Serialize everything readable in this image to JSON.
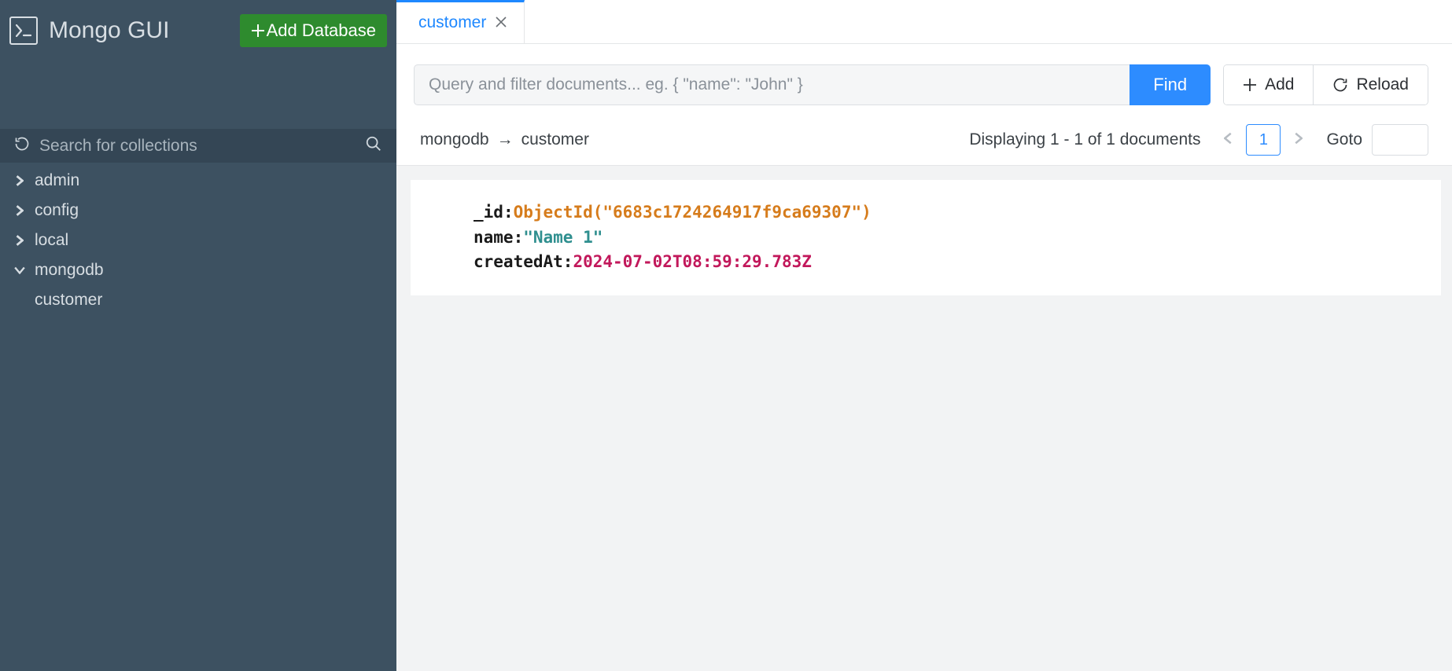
{
  "app": {
    "title": "Mongo GUI"
  },
  "sidebar": {
    "add_db_label": "Add Database",
    "search_placeholder": "Search for collections",
    "databases": [
      {
        "name": "admin",
        "expanded": false
      },
      {
        "name": "config",
        "expanded": false
      },
      {
        "name": "local",
        "expanded": false
      },
      {
        "name": "mongodb",
        "expanded": true,
        "collections": [
          {
            "name": "customer"
          }
        ]
      }
    ]
  },
  "tabs": [
    {
      "label": "customer",
      "active": true
    }
  ],
  "query": {
    "placeholder": "Query and filter documents... eg. { \"name\": \"John\" }",
    "find_label": "Find",
    "add_label": "Add",
    "reload_label": "Reload"
  },
  "pathbar": {
    "db": "mongodb",
    "collection": "customer",
    "status": "Displaying 1 - 1 of 1 documents",
    "page": "1",
    "goto_label": "Goto"
  },
  "document": {
    "fields": [
      {
        "key": "_id",
        "value": "ObjectId(\"6683c1724264917f9ca69307\")",
        "type": "objectid"
      },
      {
        "key": "name",
        "value": "\"Name 1\"",
        "type": "string"
      },
      {
        "key": "createdAt",
        "value": "2024-07-02T08:59:29.783Z",
        "type": "date"
      }
    ]
  }
}
